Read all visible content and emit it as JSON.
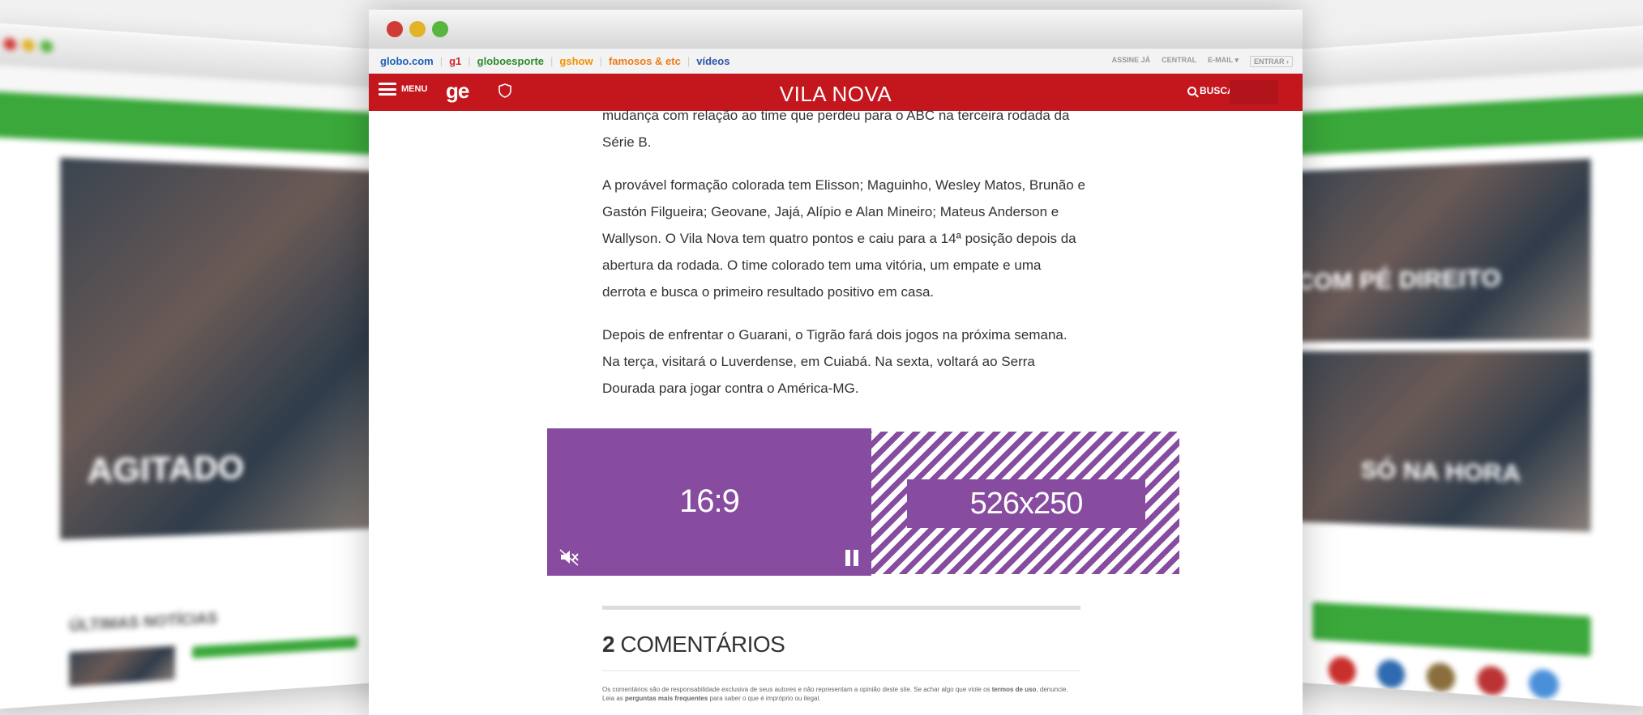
{
  "left_window": {
    "headline": "AGITADO",
    "section_label": "ÚLTIMAS NOTÍCIAS"
  },
  "right_window": {
    "headline_1": "COM PÉ DIREITO",
    "headline_2": "SÓ NA HORA"
  },
  "globo_bar": {
    "links": [
      "globo.com",
      "g1",
      "globoesporte",
      "gshow",
      "famosos & etc",
      "vídeos"
    ],
    "right_links": [
      "ASSINE JÁ",
      "CENTRAL",
      "E-MAIL ▾",
      "ENTRAR ›"
    ]
  },
  "header": {
    "menu_label": "MENU",
    "logo": "ge",
    "section_title": "VILA NOVA",
    "search_label": "BUSCAR"
  },
  "article": {
    "paragraphs": [
      "mudança com relação ao time que perdeu para o ABC na terceira rodada da Série B.",
      "A provável formação colorada tem Elisson; Maguinho, Wesley Matos, Brunão e Gastón Filgueira; Geovane, Jajá, Alípio e Alan Mineiro; Mateus Anderson e Wallyson. O Vila Nova tem quatro pontos e caiu para a 14ª posição depois da abertura da rodada. O time colorado tem uma vitória, um empate e uma derrota e busca o primeiro resultado positivo em casa.",
      "Depois de enfrentar o Guarani, o Tigrão fará dois jogos na próxima semana. Na terça, visitará o Luverdense, em Cuiabá. Na sexta, voltará ao Serra Dourada para jogar contra o América-MG."
    ]
  },
  "ad": {
    "video_ratio": "16:9",
    "size_label": "526x250"
  },
  "comments": {
    "count": "2",
    "label": "COMENTÁRIOS",
    "disclaimer_1": "Os comentários são de responsabilidade exclusiva de seus autores e não representam a opinião deste site. Se achar algo que viole os",
    "terms": "termos de uso",
    "disclaimer_2": ", denuncie. Leia as",
    "faq": "perguntas mais frequentes",
    "disclaimer_3": "para saber o que é impróprio ou ilegal."
  },
  "colors": {
    "brand_red": "#c4171d",
    "ad_purple": "#874b9f",
    "side_green": "#3aa83a"
  }
}
